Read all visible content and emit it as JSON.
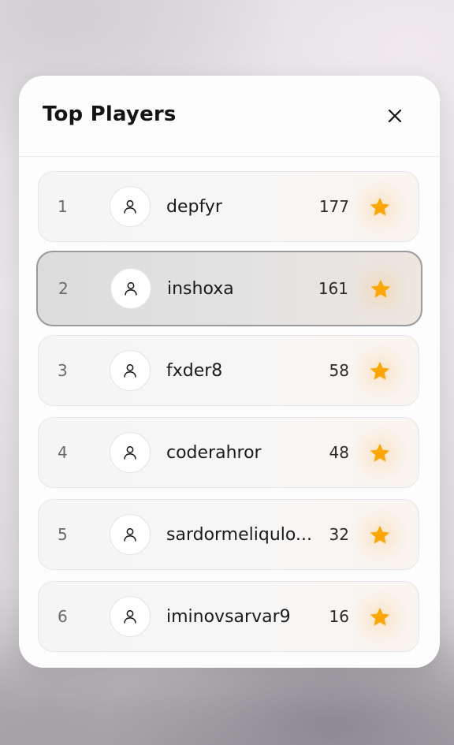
{
  "modal": {
    "title": "Top Players",
    "close_icon": "close-icon"
  },
  "players": [
    {
      "rank": "1",
      "username": "depfyr",
      "score": "177",
      "avatar_icon": "user-icon",
      "badge_icon": "star-icon"
    },
    {
      "rank": "2",
      "username": "inshoxa",
      "score": "161",
      "avatar_icon": "user-icon",
      "badge_icon": "star-icon",
      "highlighted": true
    },
    {
      "rank": "3",
      "username": "fxder8",
      "score": "58",
      "avatar_icon": "user-icon",
      "badge_icon": "star-icon"
    },
    {
      "rank": "4",
      "username": "coderahror",
      "score": "48",
      "avatar_icon": "user-icon",
      "badge_icon": "star-icon"
    },
    {
      "rank": "5",
      "username": "sardormeliqulo...",
      "score": "32",
      "avatar_icon": "user-icon",
      "badge_icon": "star-icon"
    },
    {
      "rank": "6",
      "username": "iminovsarvar9",
      "score": "16",
      "avatar_icon": "user-icon",
      "badge_icon": "star-icon"
    }
  ],
  "colors": {
    "star": "#FFA600",
    "title_text": "#141414",
    "highlight_border": "#9B999C"
  }
}
